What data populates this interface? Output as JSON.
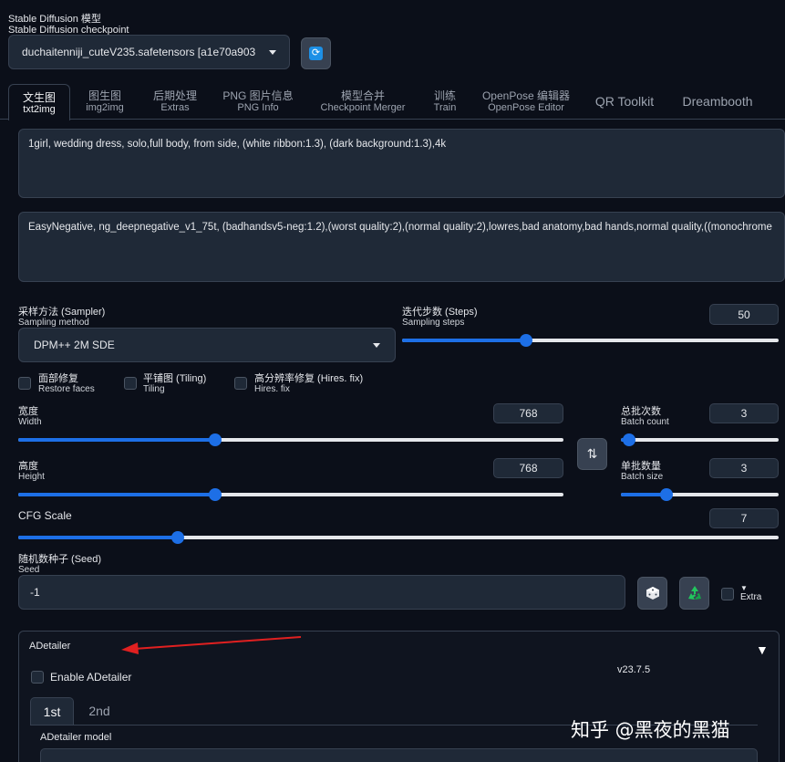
{
  "checkpoint": {
    "label_zh": "Stable Diffusion 模型",
    "label_en": "Stable Diffusion checkpoint",
    "value": "duchaitenniji_cuteV235.safetensors [a1e70a903"
  },
  "tabs": [
    {
      "zh": "文生图",
      "en": "txt2img"
    },
    {
      "zh": "图生图",
      "en": "img2img"
    },
    {
      "zh": "后期处理",
      "en": "Extras"
    },
    {
      "zh": "PNG 图片信息",
      "en": "PNG Info"
    },
    {
      "zh": "模型合并",
      "en": "Checkpoint Merger"
    },
    {
      "zh": "训练",
      "en": "Train"
    },
    {
      "zh": "OpenPose 编辑器",
      "en": "OpenPose Editor"
    },
    {
      "label": "QR Toolkit"
    },
    {
      "label": "Dreambooth"
    }
  ],
  "prompt": {
    "positive": "1girl, wedding dress, solo,full body, from side, (white ribbon:1.3), (dark background:1.3),4k",
    "negative": "EasyNegative, ng_deepnegative_v1_75t, (badhandsv5-neg:1.2),(worst quality:2),(normal quality:2),lowres,bad anatomy,bad hands,normal quality,((monochrome"
  },
  "sampler": {
    "label_zh": "采样方法 (Sampler)",
    "label_en": "Sampling method",
    "value": "DPM++ 2M SDE"
  },
  "steps": {
    "label_zh": "迭代步数 (Steps)",
    "label_en": "Sampling steps",
    "value": "50",
    "fraction": 0.33
  },
  "checks": {
    "restore": {
      "zh": "面部修复",
      "en": "Restore faces"
    },
    "tiling": {
      "zh": "平铺图 (Tiling)",
      "en": "Tiling"
    },
    "hires": {
      "zh": "高分辨率修复 (Hires. fix)",
      "en": "Hires. fix"
    }
  },
  "width": {
    "label_zh": "宽度",
    "label_en": "Width",
    "value": "768",
    "fraction": 0.361
  },
  "height": {
    "label_zh": "高度",
    "label_en": "Height",
    "value": "768",
    "fraction": 0.361
  },
  "batch_count": {
    "label_zh": "总批次数",
    "label_en": "Batch count",
    "value": "3",
    "fraction": 0.05
  },
  "batch_size": {
    "label_zh": "单批数量",
    "label_en": "Batch size",
    "value": "3",
    "fraction": 0.29
  },
  "cfg": {
    "label": "CFG Scale",
    "value": "7",
    "fraction": 0.21
  },
  "seed": {
    "label_zh": "随机数种子 (Seed)",
    "label_en": "Seed",
    "value": "-1",
    "extra_label": "Extra"
  },
  "adetailer": {
    "title": "ADetailer",
    "enable_label": "Enable ADetailer",
    "version": "v23.7.5",
    "tabs": [
      "1st",
      "2nd"
    ],
    "model_label": "ADetailer model"
  },
  "watermark": "知乎 @黑夜的黑猫",
  "colors": {
    "accent": "#1d6fe6",
    "arrow": "#e02020",
    "bg": "#0b0f19"
  }
}
